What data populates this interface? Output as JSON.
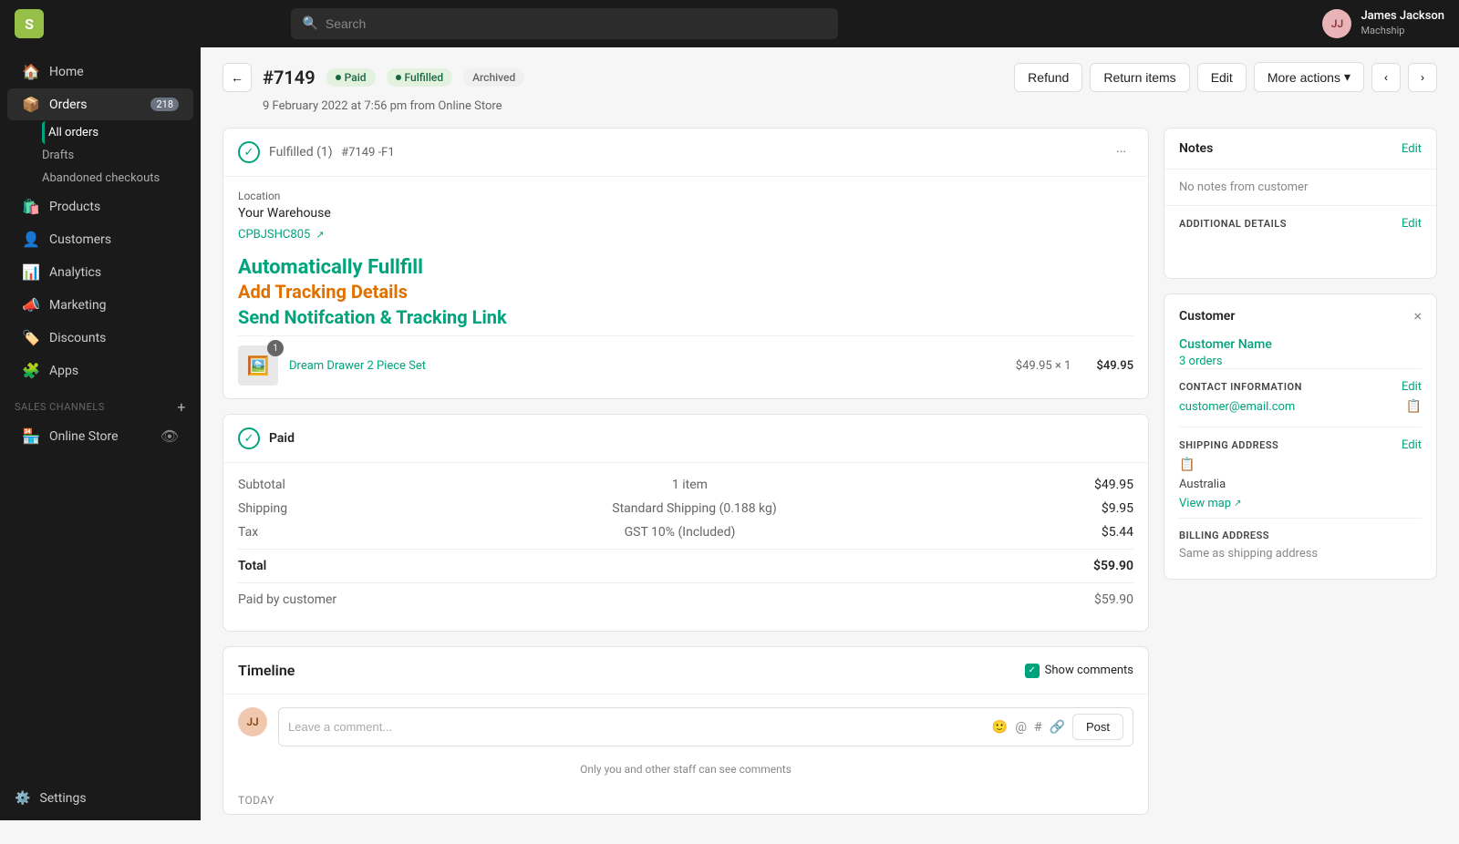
{
  "topnav": {
    "logo": "S",
    "search_placeholder": "Search",
    "user_initials": "JJ",
    "user_name": "James Jackson",
    "user_org": "Machship"
  },
  "sidebar": {
    "items": [
      {
        "id": "home",
        "label": "Home",
        "icon": "🏠",
        "badge": null
      },
      {
        "id": "orders",
        "label": "Orders",
        "icon": "📦",
        "badge": "218"
      },
      {
        "id": "products",
        "label": "Products",
        "icon": "🛍️",
        "badge": null
      },
      {
        "id": "customers",
        "label": "Customers",
        "icon": "👤",
        "badge": null
      },
      {
        "id": "analytics",
        "label": "Analytics",
        "icon": "📊",
        "badge": null
      },
      {
        "id": "marketing",
        "label": "Marketing",
        "icon": "📣",
        "badge": null
      },
      {
        "id": "discounts",
        "label": "Discounts",
        "icon": "🏷️",
        "badge": null
      },
      {
        "id": "apps",
        "label": "Apps",
        "icon": "🧩",
        "badge": null
      }
    ],
    "sub_orders": [
      {
        "id": "all-orders",
        "label": "All orders",
        "active": true
      },
      {
        "id": "drafts",
        "label": "Drafts",
        "active": false
      },
      {
        "id": "abandoned-checkouts",
        "label": "Abandoned checkouts",
        "active": false
      }
    ],
    "sales_channels_label": "SALES CHANNELS",
    "sales_channels": [
      {
        "id": "online-store",
        "label": "Online Store"
      }
    ],
    "settings_label": "Settings"
  },
  "order": {
    "back_label": "←",
    "order_number": "#7149",
    "badges": {
      "paid": "Paid",
      "fulfilled": "Fulfilled",
      "archived": "Archived"
    },
    "actions": {
      "refund": "Refund",
      "return_items": "Return items",
      "edit": "Edit",
      "more_actions": "More actions",
      "prev": "‹",
      "next": "›"
    },
    "date": "9 February 2022 at 7:56 pm from Online Store"
  },
  "fulfillment": {
    "title": "Fulfilled (1)",
    "order_ref": "#7149 -F1",
    "more": "···",
    "location_label": "Location",
    "location": "Your Warehouse",
    "tracking_code": "CPBJSHC805",
    "promo_auto": "Automatically Fullfill",
    "promo_tracking": "Add Tracking Details",
    "promo_send": "Send Notifcation & Tracking Link",
    "product": {
      "name": "Dream Drawer 2 Piece Set",
      "qty": "1",
      "unit_price": "$49.95 × 1",
      "total": "$49.95",
      "icon": "🖼️"
    }
  },
  "payment": {
    "title": "Paid",
    "subtotal_label": "Subtotal",
    "subtotal_detail": "1 item",
    "subtotal_amount": "$49.95",
    "shipping_label": "Shipping",
    "shipping_detail": "Standard Shipping (0.188 kg)",
    "shipping_amount": "$9.95",
    "tax_label": "Tax",
    "tax_detail": "GST 10% (Included)",
    "tax_amount": "$5.44",
    "total_label": "Total",
    "total_amount": "$59.90",
    "paid_label": "Paid by customer",
    "paid_amount": "$59.90"
  },
  "timeline": {
    "title": "Timeline",
    "show_comments_label": "Show comments",
    "comment_placeholder": "Leave a comment...",
    "comment_hint": "Only you and other staff can see comments",
    "post_label": "Post",
    "today_label": "TODAY",
    "user_initials": "JJ"
  },
  "notes": {
    "title": "Notes",
    "edit_label": "Edit",
    "no_notes": "No notes from customer",
    "additional_details_label": "ADDITIONAL DETAILS",
    "additional_edit": "Edit"
  },
  "customer": {
    "title": "Customer",
    "close": "×",
    "name": "Customer Name",
    "orders": "3 orders",
    "contact_label": "CONTACT INFORMATION",
    "contact_edit": "Edit",
    "email": "customer@email.com",
    "shipping_label": "SHIPPING ADDRESS",
    "shipping_edit": "Edit",
    "country": "Australia",
    "view_map": "View map",
    "billing_label": "BILLING ADDRESS",
    "billing_same": "Same as shipping address"
  }
}
